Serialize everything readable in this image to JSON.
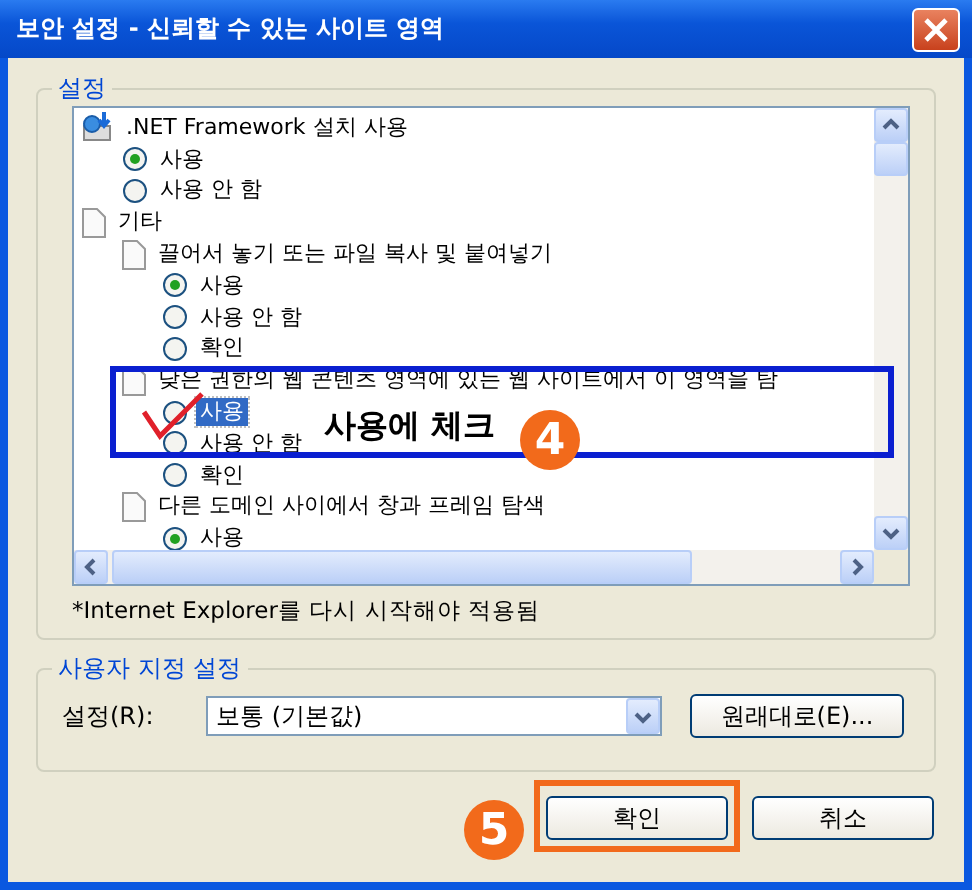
{
  "window": {
    "title": "보안 설정 - 신뢰할 수 있는 사이트 영역"
  },
  "settings_group": {
    "legend": "설정",
    "tree": [
      {
        "kind": "net",
        "label": ".NET Framework 설치 사용",
        "children": [
          {
            "kind": "radio",
            "label": "사용",
            "selected": true,
            "highlighted": false
          },
          {
            "kind": "radio",
            "label": "사용 안 함",
            "selected": false,
            "highlighted": false
          }
        ]
      },
      {
        "kind": "doc",
        "label": "기타",
        "children": [
          {
            "kind": "doc",
            "label": "끌어서 놓기 또는 파일 복사 및 붙여넣기",
            "children": [
              {
                "kind": "radio",
                "label": "사용",
                "selected": true,
                "highlighted": false
              },
              {
                "kind": "radio",
                "label": "사용 안 함",
                "selected": false,
                "highlighted": false
              },
              {
                "kind": "radio",
                "label": "확인",
                "selected": false,
                "highlighted": false
              }
            ]
          },
          {
            "kind": "doc",
            "label": "낮은 권한의 웹 콘텐츠 영역에 있는 웹 사이트에서 이 영역을 탐",
            "children": [
              {
                "kind": "radio",
                "label": "사용",
                "selected": false,
                "highlighted": true
              },
              {
                "kind": "radio",
                "label": "사용 안 함",
                "selected": false,
                "highlighted": false
              },
              {
                "kind": "radio",
                "label": "확인",
                "selected": false,
                "highlighted": false
              }
            ]
          },
          {
            "kind": "doc",
            "label": "다른 도메인 사이에서 창과 프레임 탐색",
            "children": [
              {
                "kind": "radio",
                "label": "사용",
                "selected": true,
                "highlighted": false
              }
            ]
          }
        ]
      }
    ],
    "note": "*Internet Explorer를 다시 시작해야 적용됨"
  },
  "custom_group": {
    "legend": "사용자 지정 설정",
    "label": "설정(R):",
    "select_value": "보통 (기본값)",
    "reset_button": "원래대로(E)..."
  },
  "buttons": [
    "확인",
    "취소"
  ],
  "annotations": {
    "note": "사용에 체크",
    "step_4": "4",
    "step_5": "5"
  }
}
